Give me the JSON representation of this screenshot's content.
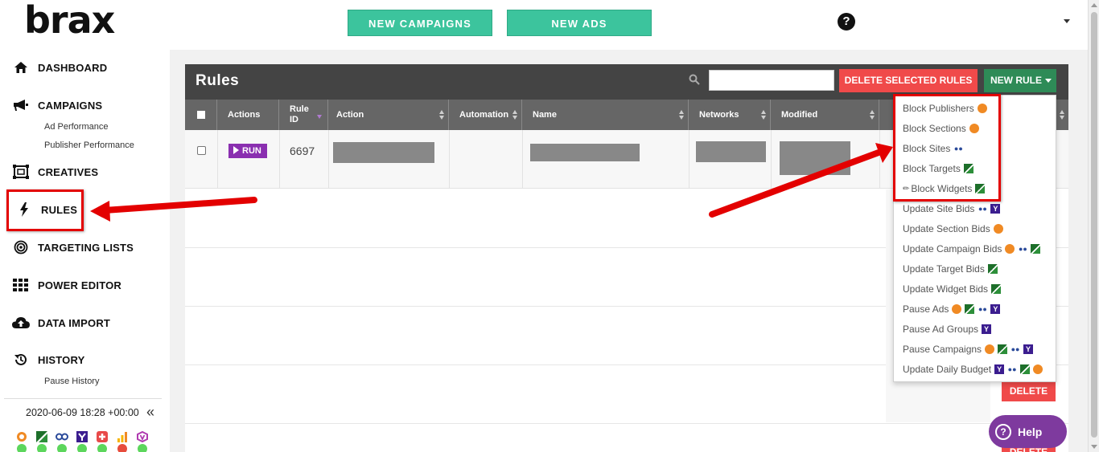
{
  "header": {
    "logo": "brax",
    "new_campaigns": "NEW CAMPAIGNS",
    "new_ads": "NEW ADS",
    "help_glyph": "?"
  },
  "sidebar": {
    "items": [
      {
        "label": "DASHBOARD",
        "icon": "home-icon"
      },
      {
        "label": "CAMPAIGNS",
        "icon": "megaphone-icon"
      },
      {
        "label": "CREATIVES",
        "icon": "creatives-icon"
      },
      {
        "label": "RULES",
        "icon": "lightning-icon"
      },
      {
        "label": "TARGETING LISTS",
        "icon": "target-icon"
      },
      {
        "label": "POWER EDITOR",
        "icon": "grid-icon"
      },
      {
        "label": "DATA IMPORT",
        "icon": "cloud-upload-icon"
      },
      {
        "label": "HISTORY",
        "icon": "history-icon"
      }
    ],
    "sub_campaigns": [
      "Ad Performance",
      "Publisher Performance"
    ],
    "sub_history": [
      "Pause History"
    ],
    "timestamp": "2020-06-09 18:28 +00:00",
    "collapse": "«",
    "networks": [
      {
        "icon": "outbrain-icon",
        "status": "#5cd65c"
      },
      {
        "icon": "taboola-icon",
        "status": "#5cd65c"
      },
      {
        "icon": "revcontent-icon",
        "status": "#5cd65c"
      },
      {
        "icon": "yahoo-icon",
        "status": "#5cd65c"
      },
      {
        "icon": "mgid-icon",
        "status": "#5cd65c"
      },
      {
        "icon": "analytics-icon",
        "status": "#e74c3c"
      },
      {
        "icon": "voluum-icon",
        "status": "#5cd65c"
      }
    ]
  },
  "rules": {
    "title": "Rules",
    "search_placeholder": "",
    "delete_selected": "DELETE SELECTED RULES",
    "new_rule": "NEW RULE",
    "columns": [
      "Actions",
      "Rule ID",
      "Action",
      "Automation",
      "Name",
      "Networks",
      "Modified"
    ],
    "row": {
      "run": "RUN",
      "rule_id": "6697"
    },
    "delete": "DELETE",
    "delete2": "DELETE"
  },
  "new_rule_menu": {
    "items": [
      {
        "label": "Block Publishers",
        "icons": [
          "o"
        ]
      },
      {
        "label": "Block Sections",
        "icons": [
          "o"
        ]
      },
      {
        "label": "Block Sites",
        "icons": [
          "b"
        ]
      },
      {
        "label": "Block Targets",
        "icons": [
          "g"
        ]
      },
      {
        "label": "Block Widgets",
        "icons": [
          "g"
        ]
      },
      {
        "label": "Update Site Bids",
        "icons": [
          "b",
          "y"
        ]
      },
      {
        "label": "Update Section Bids",
        "icons": [
          "o"
        ]
      },
      {
        "label": "Update Campaign Bids",
        "icons": [
          "o",
          "b",
          "g"
        ]
      },
      {
        "label": "Update Target Bids",
        "icons": [
          "g"
        ]
      },
      {
        "label": "Update Widget Bids",
        "icons": [
          "g"
        ]
      },
      {
        "label": "Pause Ads",
        "icons": [
          "o",
          "g",
          "b",
          "y"
        ]
      },
      {
        "label": "Pause Ad Groups",
        "icons": [
          "y"
        ]
      },
      {
        "label": "Pause Campaigns",
        "icons": [
          "o",
          "g",
          "b",
          "y"
        ]
      },
      {
        "label": "Update Daily Budget",
        "icons": [
          "y",
          "b",
          "g",
          "o"
        ]
      }
    ]
  },
  "help_widget": {
    "label": "Help",
    "glyph": "?"
  }
}
